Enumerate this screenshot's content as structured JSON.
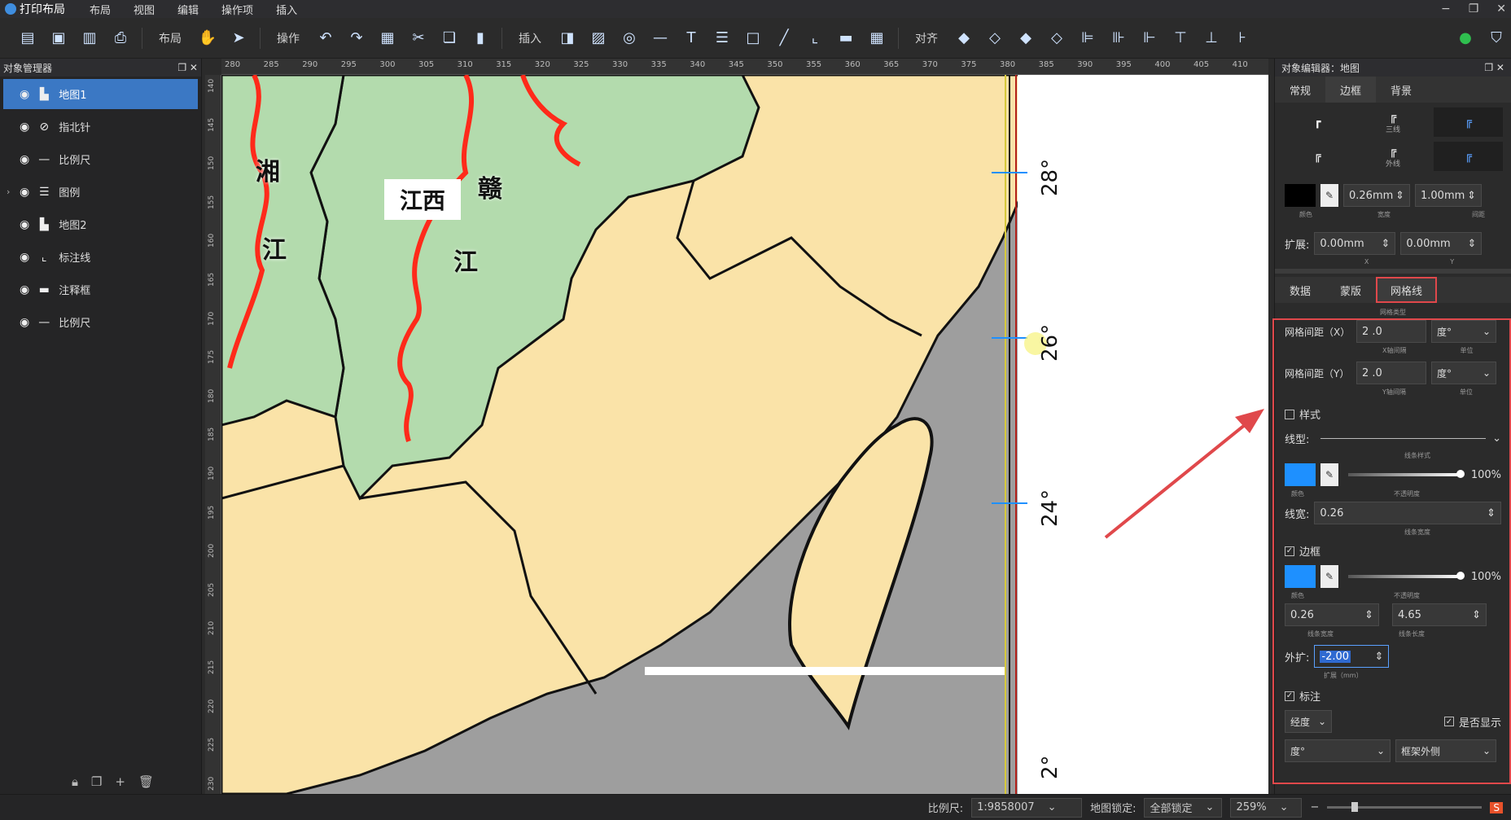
{
  "app": {
    "title": "打印布局"
  },
  "menu": [
    "布局",
    "视图",
    "编辑",
    "操作项",
    "插入"
  ],
  "toolbar": {
    "layout_label": "布局",
    "operate_label": "操作",
    "insert_label": "插入",
    "align_label": "对齐"
  },
  "object_manager": {
    "title": "对象管理器",
    "items": [
      {
        "label": "地图1",
        "icon": "map-icon",
        "selected": true
      },
      {
        "label": "指北针",
        "icon": "compass-icon"
      },
      {
        "label": "比例尺",
        "icon": "scalebar-icon"
      },
      {
        "label": "图例",
        "icon": "legend-icon",
        "expandable": true
      },
      {
        "label": "地图2",
        "icon": "map-icon"
      },
      {
        "label": "标注线",
        "icon": "leader-line-icon"
      },
      {
        "label": "注释框",
        "icon": "note-box-icon"
      },
      {
        "label": "比例尺",
        "icon": "scalebar-icon"
      }
    ]
  },
  "ruler": {
    "top": [
      "280",
      "285",
      "290",
      "295",
      "300",
      "305",
      "310",
      "315",
      "320",
      "325",
      "330",
      "335",
      "340",
      "345",
      "350",
      "355",
      "360",
      "365",
      "370",
      "375",
      "380",
      "385",
      "390",
      "395",
      "400",
      "405",
      "410"
    ],
    "left": [
      "140",
      "145",
      "150",
      "155",
      "160",
      "165",
      "170",
      "175",
      "180",
      "185",
      "190",
      "195",
      "200",
      "205",
      "210",
      "215",
      "220",
      "225",
      "230"
    ]
  },
  "map": {
    "labels": {
      "xiang": "湘",
      "jiang1": "江",
      "gan": "赣",
      "jiang2": "江",
      "jiangxi": "江西"
    },
    "grid_labels": [
      "28°",
      "26°",
      "24°",
      "2°"
    ],
    "colors": {
      "land": "#fae3a8",
      "province": "#b3dbad",
      "sea": "#9e9e9e",
      "river": "#ff2a1a"
    }
  },
  "object_editor": {
    "title": "对象编辑器：地图",
    "tabs": [
      "常规",
      "边框",
      "背景"
    ],
    "active_tab": "边框",
    "border_styles": [
      {
        "glyph": "┏",
        "label": ""
      },
      {
        "glyph": "╔",
        "label": "三线"
      },
      {
        "glyph": "╔",
        "label": ""
      },
      {
        "glyph": "╔",
        "label": ""
      },
      {
        "glyph": "╔",
        "label": "外线"
      },
      {
        "glyph": "╔",
        "label": ""
      }
    ],
    "border_color_label": "颜色",
    "border_width": "0.26mm",
    "border_width_label": "宽度",
    "border_gap": "1.00mm",
    "border_gap_label": "间距",
    "extend_label": "扩展:",
    "extend_x": "0.00mm",
    "extend_y": "0.00mm",
    "x_label": "X",
    "y_label": "Y",
    "sub_tabs": [
      "数据",
      "蒙版",
      "网格线"
    ],
    "active_sub_tab": "网格线"
  },
  "grid": {
    "type_label": "网格类型",
    "spacing_x_label": "网格间距（X）",
    "spacing_x": "2 .0",
    "spacing_x_sub": "X轴间隔",
    "unit_x": "度°",
    "unit_label": "单位",
    "spacing_y_label": "网格间距（Y）",
    "spacing_y": "2 .0",
    "spacing_y_sub": "Y轴间隔",
    "unit_y": "度°",
    "style_label": "样式",
    "style_checked": false,
    "line_type_label": "线型:",
    "line_style_sub": "线条样式",
    "line_color": "#1e90ff",
    "color_sub": "颜色",
    "opacity1": "100%",
    "opacity_sub": "不透明度",
    "line_width_label": "线宽:",
    "line_width": "0.26",
    "line_width_sub": "线条宽度",
    "frame_label": "边框",
    "frame_checked": true,
    "frame_color": "#1e90ff",
    "opacity2": "100%",
    "frame_width": "0.26",
    "frame_width_sub": "线条宽度",
    "frame_length": "4.65",
    "frame_length_sub": "线条长度",
    "outer_label": "外扩:",
    "outer_value": "-2.00",
    "outer_sub": "扩展（mm）",
    "annotation_label": "标注",
    "annotation_checked": true,
    "annotation_type": "经度",
    "show_label": "是否显示",
    "show_checked": true,
    "anno_unit": "度°",
    "anno_position": "框架外侧"
  },
  "status": {
    "scale_label": "比例尺:",
    "scale_value": "1:9858007",
    "lock_label": "地图锁定:",
    "lock_value": "全部锁定",
    "zoom": "259%"
  }
}
